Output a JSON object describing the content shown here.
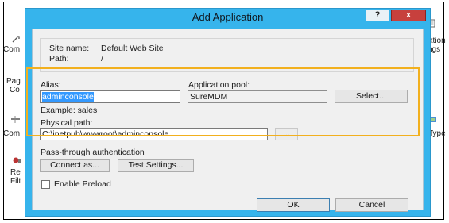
{
  "dialog": {
    "title": "Add Application",
    "help_label": "?",
    "close_label": "x",
    "site_name_label": "Site name:",
    "site_name_value": "Default Web Site",
    "path_label": "Path:",
    "path_value": "/",
    "alias_label": "Alias:",
    "alias_value": "adminconsole",
    "alias_example": "Example: sales",
    "app_pool_label": "Application pool:",
    "app_pool_value": "SureMDM",
    "select_label": "Select...",
    "physical_path_label": "Physical path:",
    "physical_path_value": "C:\\inetpub\\wwwroot\\adminconsole",
    "browse_label": "...",
    "passthrough_label": "Pass-through authentication",
    "connect_as_label": "Connect as...",
    "test_settings_label": "Test Settings...",
    "enable_preload_label": "Enable Preload",
    "enable_preload_checked": false,
    "ok_label": "OK",
    "cancel_label": "Cancel"
  },
  "background": {
    "left_fragments": [
      "Com",
      "Pag",
      "Co",
      "Com",
      "Re",
      "Filt"
    ],
    "right_fragments": [
      "cation",
      "ngs",
      "Type"
    ]
  },
  "colors": {
    "dialog_frame": "#36b4ec",
    "highlight": "#f2b01e",
    "close_button": "#c7403d",
    "selection": "#3399ff"
  }
}
